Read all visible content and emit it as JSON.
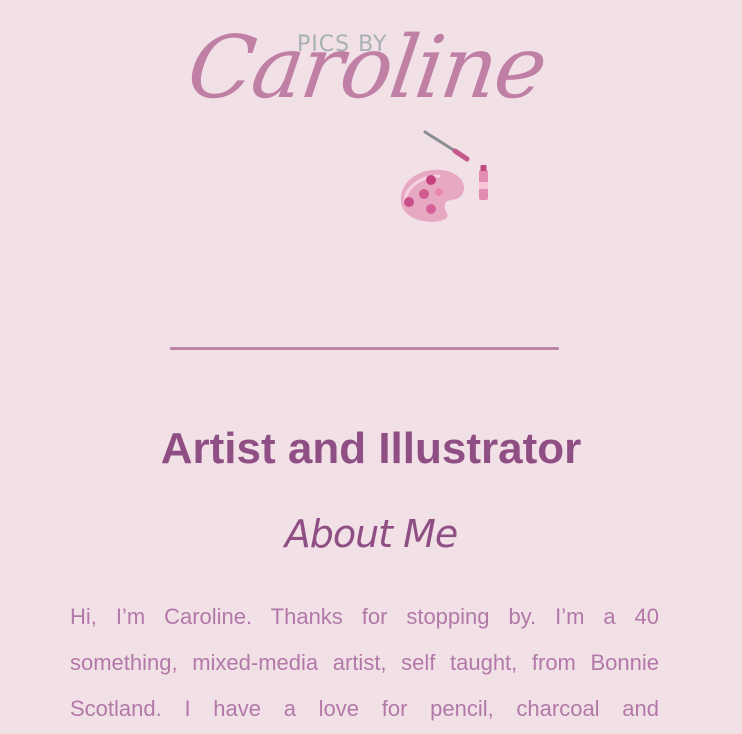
{
  "logo": {
    "top_text": "PICS BY",
    "script_text": "Caroline",
    "icon": "paint-palette-icon"
  },
  "main": {
    "title": "Artist and Illustrator",
    "section_title": "About Me",
    "about_lines": [
      "Hi, I’m Caroline. Thanks for stopping by. I’m a 40",
      "something, mixed-media artist, self taught, from Bonnie",
      "Scotland. I have a love for pencil, charcoal and"
    ]
  },
  "colors": {
    "background": "#f2e0e7",
    "heading": "#8f4f84",
    "body_text": "#b279a8",
    "logo_script": "#c07fa4",
    "logo_top": "#a8b0b3",
    "divider": "#bb85a3"
  }
}
